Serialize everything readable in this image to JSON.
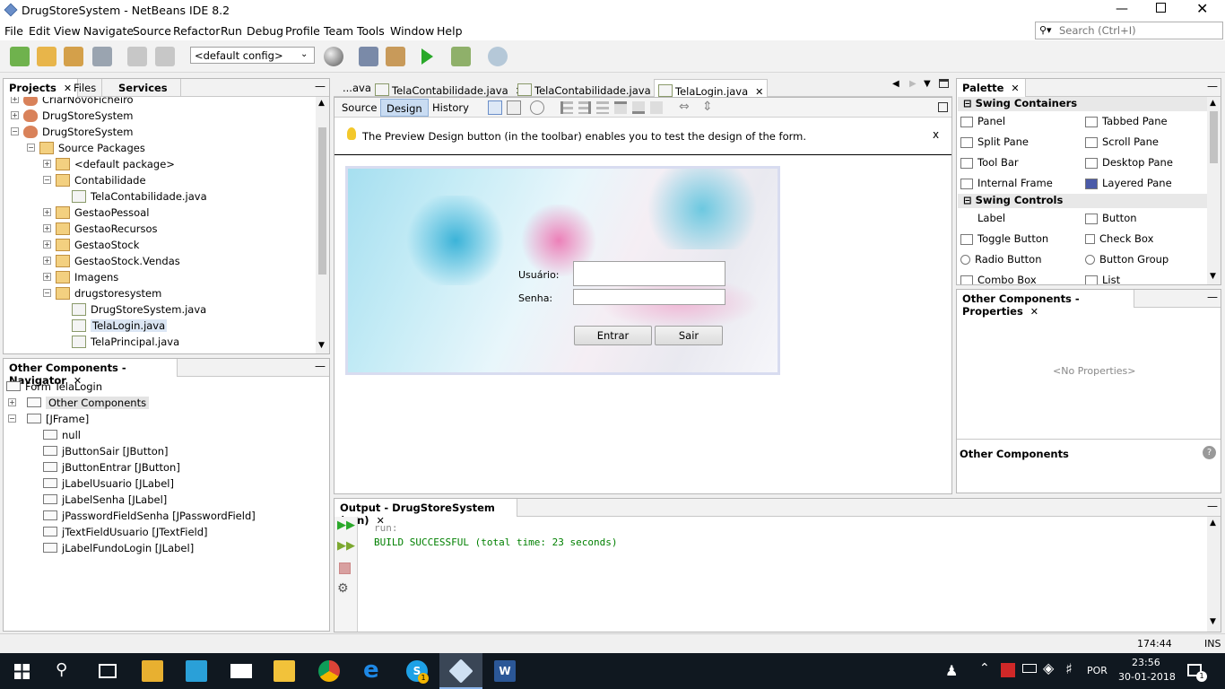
{
  "window": {
    "title": "DrugStoreSystem - NetBeans IDE 8.2"
  },
  "menu": [
    "File",
    "Edit",
    "View",
    "Navigate",
    "Source",
    "Refactor",
    "Run",
    "Debug",
    "Profile",
    "Team",
    "Tools",
    "Window",
    "Help"
  ],
  "search": {
    "placeholder": "Search (Ctrl+I)"
  },
  "toolbar": {
    "config": "<default config>"
  },
  "projects_panel": {
    "tabs": [
      "Projects",
      "Files",
      "Services"
    ],
    "tree": [
      {
        "label": "CriarNovoFicheiro",
        "depth": 0,
        "icon": "project-icon"
      },
      {
        "label": "DrugStoreSystem",
        "depth": 0,
        "icon": "project-icon"
      },
      {
        "label": "DrugStoreSystem",
        "depth": 0,
        "icon": "project-icon"
      },
      {
        "label": "Source Packages",
        "depth": 1,
        "icon": "package-icon"
      },
      {
        "label": "<default package>",
        "depth": 2,
        "icon": "package-icon"
      },
      {
        "label": "Contabilidade",
        "depth": 2,
        "icon": "package-icon"
      },
      {
        "label": "TelaContabilidade.java",
        "depth": 3,
        "icon": "java-file-icon"
      },
      {
        "label": "GestaoPessoal",
        "depth": 2,
        "icon": "package-icon"
      },
      {
        "label": "GestaoRecursos",
        "depth": 2,
        "icon": "package-icon"
      },
      {
        "label": "GestaoStock",
        "depth": 2,
        "icon": "package-icon"
      },
      {
        "label": "GestaoStock.Vendas",
        "depth": 2,
        "icon": "package-icon"
      },
      {
        "label": "Imagens",
        "depth": 2,
        "icon": "package-icon"
      },
      {
        "label": "drugstoresystem",
        "depth": 2,
        "icon": "package-icon"
      },
      {
        "label": "DrugStoreSystem.java",
        "depth": 3,
        "icon": "java-file-icon"
      },
      {
        "label": "TelaLogin.java",
        "depth": 3,
        "icon": "java-file-icon",
        "selected": true
      },
      {
        "label": "TelaPrincipal.java",
        "depth": 3,
        "icon": "java-file-icon"
      }
    ]
  },
  "navigator": {
    "title": "Other Components - Navigator",
    "items": [
      "Form TelaLogin",
      "Other Components",
      "[JFrame]",
      "null",
      "jButtonSair [JButton]",
      "jButtonEntrar [JButton]",
      "jLabelUsuario [JLabel]",
      "jLabelSenha [JLabel]",
      "jPasswordFieldSenha [JPasswordField]",
      "jTextFieldUsuario [JTextField]",
      "jLabelFundoLogin [JLabel]"
    ]
  },
  "editor": {
    "tabs": [
      "...ava",
      "TelaContabilidade.java",
      "TelaContabilidade.java",
      "TelaLogin.java"
    ],
    "views": [
      "Source",
      "Design",
      "History"
    ],
    "hint": "The Preview Design button (in the toolbar) enables you to test the design of the form.",
    "hint_close": "x",
    "form": {
      "user_label": "Usuário:",
      "pass_label": "Senha:",
      "enter": "Entrar",
      "exit": "Sair"
    }
  },
  "palette": {
    "title": "Palette",
    "sections": [
      {
        "name": "Swing Containers",
        "items": [
          "Panel",
          "Tabbed Pane",
          "Split Pane",
          "Scroll Pane",
          "Tool Bar",
          "Desktop Pane",
          "Internal Frame",
          "Layered Pane"
        ]
      },
      {
        "name": "Swing Controls",
        "items": [
          "Label",
          "Button",
          "Toggle Button",
          "Check Box",
          "Radio Button",
          "Button Group",
          "Combo Box",
          "List"
        ]
      }
    ]
  },
  "properties": {
    "title": "Other Components - Properties",
    "empty": "<No Properties>",
    "footer": "Other Components"
  },
  "output": {
    "title": "Output - DrugStoreSystem (run)",
    "lines": [
      "run:",
      "BUILD SUCCESSFUL (total time: 23 seconds)"
    ]
  },
  "status": {
    "position": "174:44",
    "mode": "INS"
  },
  "taskbar": {
    "lang": "POR",
    "time": "23:56",
    "date": "30-01-2018",
    "notif": "1"
  },
  "colors": {
    "accent": "#2b6cb0",
    "output_green": "#008000"
  }
}
